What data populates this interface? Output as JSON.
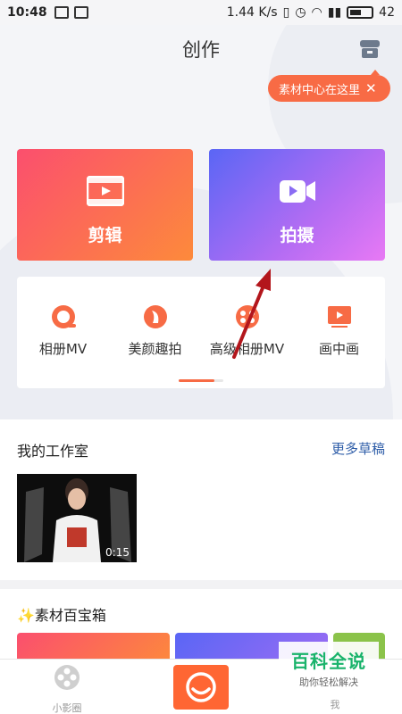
{
  "status_bar": {
    "time": "10:48",
    "speed": "1.44 K/s",
    "battery": "42"
  },
  "header": {
    "title": "创作",
    "tooltip": "素材中心在这里",
    "tooltip_close": "✕"
  },
  "cards": {
    "edit_label": "剪辑",
    "shoot_label": "拍摄"
  },
  "tools": [
    {
      "label": "相册MV",
      "icon": "album-mv-icon"
    },
    {
      "label": "美颜趣拍",
      "icon": "beauty-shot-icon"
    },
    {
      "label": "高级相册MV",
      "icon": "advanced-album-mv-icon"
    },
    {
      "label": "画中画",
      "icon": "picture-in-picture-icon"
    }
  ],
  "studio": {
    "title": "我的工作室",
    "more": "更多草稿",
    "draft_duration": "0:15"
  },
  "materials": {
    "title": "素材百宝箱"
  },
  "bottom_nav": {
    "left_label": "小影圈",
    "right_label": "我"
  },
  "watermark": {
    "line1": "百科全说",
    "line2": "助你轻松解决"
  },
  "colors": {
    "accent": "#f86b45",
    "link": "#2e5da8",
    "edit_gradient": "#fb4f6e",
    "shoot_gradient": "#5a66f5"
  }
}
